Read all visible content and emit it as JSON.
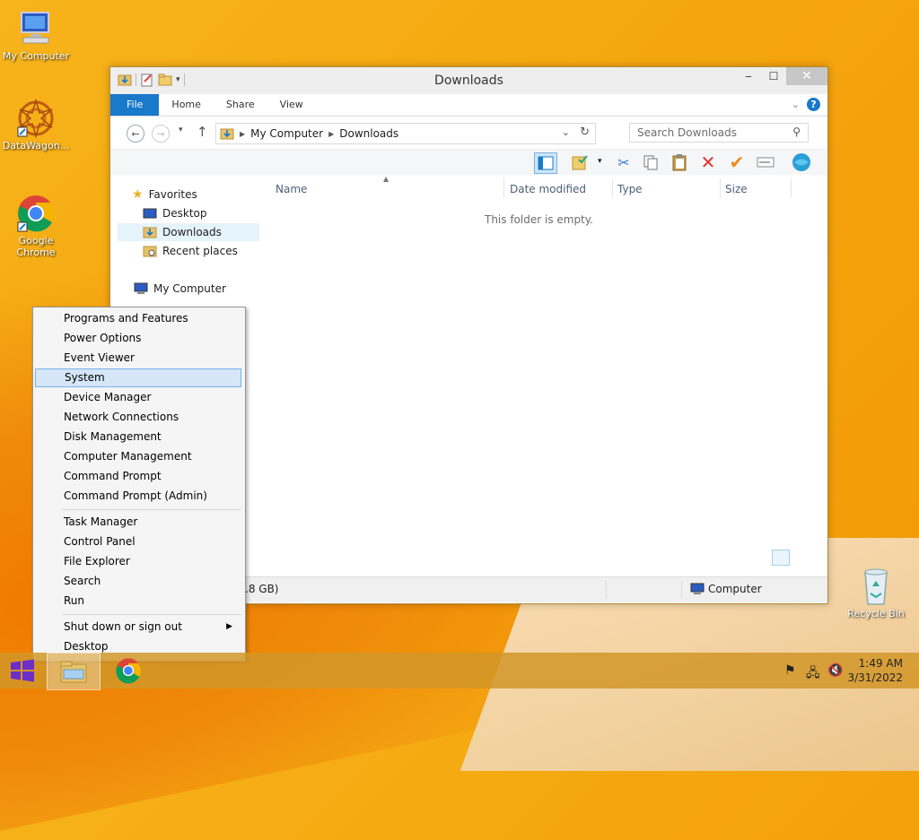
{
  "desktop": {
    "icons": [
      {
        "label": "My Computer"
      },
      {
        "label": "DataWagon..."
      },
      {
        "label": "Google Chrome"
      },
      {
        "label": "Recycle Bin"
      }
    ]
  },
  "window": {
    "title": "Downloads",
    "tabs": [
      "File",
      "Home",
      "Share",
      "View"
    ],
    "address": {
      "segments": [
        "My Computer",
        "Downloads"
      ]
    },
    "search_placeholder": "Search Downloads",
    "nav": {
      "favorites": "Favorites",
      "items": [
        "Desktop",
        "Downloads",
        "Recent places"
      ],
      "computer": "My Computer"
    },
    "columns": [
      "Name",
      "Date modified",
      "Type",
      "Size"
    ],
    "empty_text": "This folder is empty.",
    "status": {
      "left": ".8 GB)",
      "right": "Computer"
    }
  },
  "context_menu": {
    "group1": [
      "Programs and Features",
      "Power Options",
      "Event Viewer",
      "System",
      "Device Manager",
      "Network Connections",
      "Disk Management",
      "Computer Management",
      "Command Prompt",
      "Command Prompt (Admin)"
    ],
    "group2": [
      "Task Manager",
      "Control Panel",
      "File Explorer",
      "Search",
      "Run"
    ],
    "group3": [
      "Shut down or sign out",
      "Desktop"
    ],
    "highlighted": "System"
  },
  "taskbar": {
    "time": "1:49 AM",
    "date": "3/31/2022"
  },
  "colors": {
    "accent": "#1979ca",
    "highlight": "#d4e6f7"
  }
}
